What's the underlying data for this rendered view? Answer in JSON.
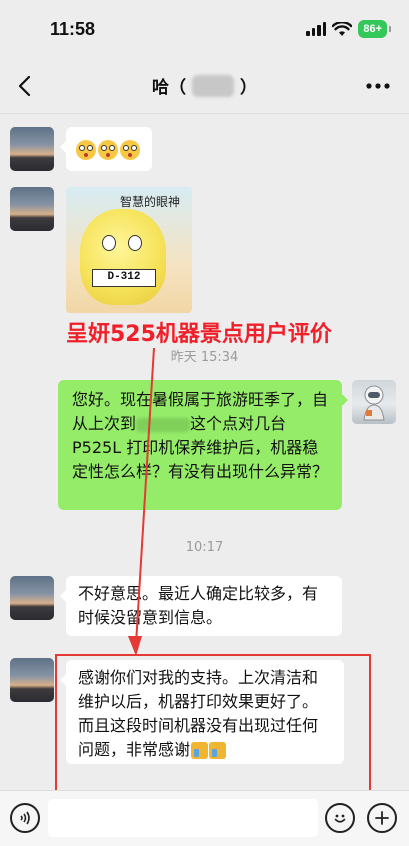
{
  "status_bar": {
    "time": "11:58",
    "battery": "86+"
  },
  "nav": {
    "title": "哈（",
    "title_close": "）"
  },
  "messages": {
    "m1_emojis": [
      "dizzy-face",
      "dizzy-face",
      "dizzy-face"
    ],
    "sticker_caption": "智慧的眼神",
    "sticker_label": "D-312",
    "overlay_caption": "呈妍525机器景点用户评价",
    "ts1": "昨天 15:34",
    "m2_text": "您好。现在暑假属于旅游旺季了，自从上次到",
    "m2_text_b": "这个点对几台 P525L 打印机保养维护后，机器稳定性怎么样？有没有出现什么异常？",
    "ts2": "10:17",
    "m3_text": "不好意思。最近人确定比较多，有时候没留意到信息。",
    "m4_text": "感谢你们对我的支持。上次清洁和维护以后，机器打印效果更好了。而且这段时间机器没有出现过任何问题，非常感谢"
  },
  "colors": {
    "chat_bg": "#ededed",
    "sent_bubble": "#95ec69",
    "received_bubble": "#ffffff",
    "annotation_red": "#f0202a"
  }
}
